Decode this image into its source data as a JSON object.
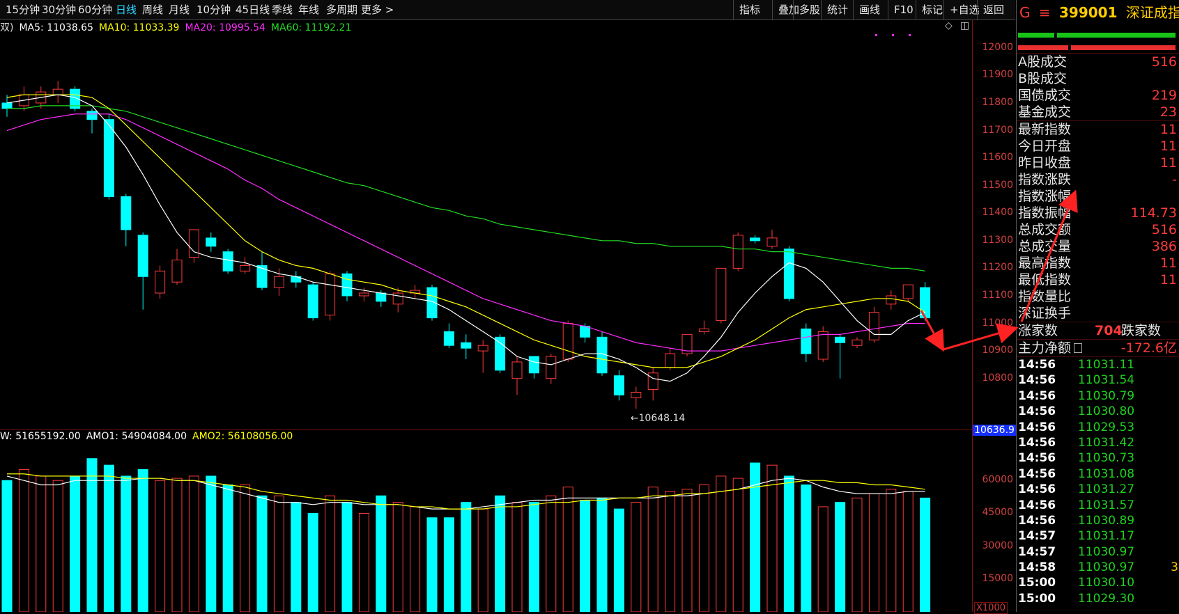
{
  "toolbar": {
    "periods": [
      "15分钟",
      "30分钟",
      "60分钟",
      "日线",
      "周线",
      "月线",
      "10分钟",
      "45日线",
      "季线",
      "年线",
      "多周期",
      "更多 >"
    ],
    "active_index": 3,
    "right_buttons": [
      "指标",
      "叠加",
      "多股",
      "统计",
      "画线",
      "F10",
      "标记",
      "+自选",
      "返回"
    ]
  },
  "main_legend": {
    "prefix": "双)",
    "items": [
      {
        "label": "MA5: 11038.65",
        "color": "#ffffff"
      },
      {
        "label": "MA10: 11033.39",
        "color": "#ffff00"
      },
      {
        "label": "MA20: 10995.54",
        "color": "#ff2bff"
      },
      {
        "label": "MA60: 11192.21",
        "color": "#22dd22"
      }
    ]
  },
  "sub_legend": {
    "items": [
      {
        "label": "W: 51655192.00",
        "color": "#ffffff"
      },
      {
        "label": "AMO1: 54904084.00",
        "color": "#ffffff"
      },
      {
        "label": "AMO2: 56108056.00",
        "color": "#ffff00"
      }
    ]
  },
  "price_axis": {
    "ticks": [
      12000,
      11900,
      11800,
      11700,
      11600,
      11500,
      11400,
      11300,
      11200,
      11100,
      11000,
      10900,
      10800
    ],
    "current_label": "10636.9",
    "low_annotation": "←10648.14"
  },
  "volume_axis": {
    "ticks": [
      "60000",
      "45000",
      "30000",
      "15000"
    ],
    "unit": "X1000"
  },
  "chart_data": {
    "type": "candlestick",
    "price_ylim": [
      10640,
      12050
    ],
    "volume_ylim": [
      0,
      75000
    ],
    "candles": [
      {
        "o": 11800,
        "c": 11780,
        "h": 11830,
        "l": 11750,
        "v": 60000
      },
      {
        "o": 11790,
        "c": 11830,
        "h": 11860,
        "l": 11770,
        "v": 65000
      },
      {
        "o": 11800,
        "c": 11840,
        "h": 11860,
        "l": 11780,
        "v": 62000
      },
      {
        "o": 11830,
        "c": 11850,
        "h": 11880,
        "l": 11800,
        "v": 60000
      },
      {
        "o": 11850,
        "c": 11780,
        "h": 11860,
        "l": 11770,
        "v": 62000
      },
      {
        "o": 11770,
        "c": 11740,
        "h": 11780,
        "l": 11690,
        "v": 70000
      },
      {
        "o": 11740,
        "c": 11460,
        "h": 11760,
        "l": 11450,
        "v": 67000
      },
      {
        "o": 11460,
        "c": 11340,
        "h": 11470,
        "l": 11280,
        "v": 62000
      },
      {
        "o": 11320,
        "c": 11170,
        "h": 11330,
        "l": 11050,
        "v": 65000
      },
      {
        "o": 11110,
        "c": 11190,
        "h": 11210,
        "l": 11090,
        "v": 60000
      },
      {
        "o": 11150,
        "c": 11230,
        "h": 11270,
        "l": 11140,
        "v": 61000
      },
      {
        "o": 11240,
        "c": 11340,
        "h": 11340,
        "l": 11220,
        "v": 62000
      },
      {
        "o": 11310,
        "c": 11280,
        "h": 11330,
        "l": 11260,
        "v": 62000
      },
      {
        "o": 11260,
        "c": 11190,
        "h": 11270,
        "l": 11180,
        "v": 58000
      },
      {
        "o": 11190,
        "c": 11210,
        "h": 11240,
        "l": 11180,
        "v": 58000
      },
      {
        "o": 11210,
        "c": 11130,
        "h": 11260,
        "l": 11120,
        "v": 53000
      },
      {
        "o": 11130,
        "c": 11170,
        "h": 11200,
        "l": 11100,
        "v": 53000
      },
      {
        "o": 11170,
        "c": 11150,
        "h": 11190,
        "l": 11130,
        "v": 50000
      },
      {
        "o": 11140,
        "c": 11020,
        "h": 11150,
        "l": 11010,
        "v": 45000
      },
      {
        "o": 11030,
        "c": 11180,
        "h": 11190,
        "l": 11010,
        "v": 53000
      },
      {
        "o": 11180,
        "c": 11100,
        "h": 11190,
        "l": 11080,
        "v": 50000
      },
      {
        "o": 11100,
        "c": 11110,
        "h": 11130,
        "l": 11080,
        "v": 45000
      },
      {
        "o": 11110,
        "c": 11080,
        "h": 11120,
        "l": 11060,
        "v": 53000
      },
      {
        "o": 11070,
        "c": 11110,
        "h": 11130,
        "l": 11040,
        "v": 50000
      },
      {
        "o": 11110,
        "c": 11120,
        "h": 11140,
        "l": 11090,
        "v": 48000
      },
      {
        "o": 11130,
        "c": 11020,
        "h": 11140,
        "l": 11010,
        "v": 43000
      },
      {
        "o": 10970,
        "c": 10920,
        "h": 11000,
        "l": 10910,
        "v": 43000
      },
      {
        "o": 10930,
        "c": 10910,
        "h": 10960,
        "l": 10870,
        "v": 50000
      },
      {
        "o": 10900,
        "c": 10920,
        "h": 10940,
        "l": 10820,
        "v": 47000
      },
      {
        "o": 10950,
        "c": 10830,
        "h": 10960,
        "l": 10820,
        "v": 53000
      },
      {
        "o": 10800,
        "c": 10860,
        "h": 10880,
        "l": 10740,
        "v": 50000
      },
      {
        "o": 10880,
        "c": 10820,
        "h": 10880,
        "l": 10800,
        "v": 50000
      },
      {
        "o": 10800,
        "c": 10880,
        "h": 10890,
        "l": 10780,
        "v": 53000
      },
      {
        "o": 10870,
        "c": 11000,
        "h": 11010,
        "l": 10860,
        "v": 57000
      },
      {
        "o": 10990,
        "c": 10950,
        "h": 11000,
        "l": 10930,
        "v": 51000
      },
      {
        "o": 10950,
        "c": 10820,
        "h": 10970,
        "l": 10810,
        "v": 52000
      },
      {
        "o": 10810,
        "c": 10740,
        "h": 10830,
        "l": 10720,
        "v": 47000
      },
      {
        "o": 10730,
        "c": 10750,
        "h": 10770,
        "l": 10690,
        "v": 50000
      },
      {
        "o": 10760,
        "c": 10820,
        "h": 10840,
        "l": 10720,
        "v": 57000
      },
      {
        "o": 10840,
        "c": 10890,
        "h": 10910,
        "l": 10830,
        "v": 55000
      },
      {
        "o": 10890,
        "c": 10960,
        "h": 10960,
        "l": 10880,
        "v": 56000
      },
      {
        "o": 10970,
        "c": 10980,
        "h": 11010,
        "l": 10960,
        "v": 58000
      },
      {
        "o": 11010,
        "c": 11200,
        "h": 11200,
        "l": 11000,
        "v": 62000
      },
      {
        "o": 11200,
        "c": 11320,
        "h": 11330,
        "l": 11190,
        "v": 61000
      },
      {
        "o": 11310,
        "c": 11300,
        "h": 11320,
        "l": 11290,
        "v": 68000
      },
      {
        "o": 11280,
        "c": 11310,
        "h": 11340,
        "l": 11270,
        "v": 67000
      },
      {
        "o": 11270,
        "c": 11090,
        "h": 11280,
        "l": 11080,
        "v": 62000
      },
      {
        "o": 10980,
        "c": 10890,
        "h": 11000,
        "l": 10860,
        "v": 58000
      },
      {
        "o": 10870,
        "c": 10970,
        "h": 10990,
        "l": 10860,
        "v": 48000
      },
      {
        "o": 10950,
        "c": 10930,
        "h": 10960,
        "l": 10800,
        "v": 50000
      },
      {
        "o": 10920,
        "c": 10940,
        "h": 10950,
        "l": 10910,
        "v": 52000
      },
      {
        "o": 10940,
        "c": 11040,
        "h": 11060,
        "l": 10930,
        "v": 54000
      },
      {
        "o": 11070,
        "c": 11100,
        "h": 11120,
        "l": 11050,
        "v": 56000
      },
      {
        "o": 11090,
        "c": 11140,
        "h": 11140,
        "l": 11080,
        "v": 55000
      },
      {
        "o": 11130,
        "c": 11020,
        "h": 11150,
        "l": 11010,
        "v": 52000
      }
    ],
    "ma5": [
      11800,
      11810,
      11820,
      11830,
      11820,
      11790,
      11720,
      11640,
      11540,
      11430,
      11330,
      11260,
      11240,
      11230,
      11220,
      11200,
      11180,
      11170,
      11150,
      11140,
      11130,
      11120,
      11110,
      11100,
      11090,
      11080,
      11050,
      11010,
      10970,
      10930,
      10880,
      10860,
      10850,
      10870,
      10890,
      10890,
      10870,
      10840,
      10800,
      10790,
      10820,
      10880,
      10950,
      11040,
      11110,
      11170,
      11220,
      11200,
      11150,
      11080,
      11010,
      10960,
      10960,
      11010,
      11040
    ],
    "ma10": [
      11820,
      11830,
      11830,
      11830,
      11830,
      11820,
      11780,
      11720,
      11660,
      11600,
      11540,
      11480,
      11420,
      11360,
      11300,
      11260,
      11230,
      11210,
      11200,
      11180,
      11160,
      11150,
      11140,
      11120,
      11110,
      11100,
      11080,
      11060,
      11030,
      11000,
      10970,
      10940,
      10920,
      10900,
      10880,
      10870,
      10860,
      10850,
      10840,
      10840,
      10840,
      10860,
      10880,
      10910,
      10940,
      10980,
      11020,
      11050,
      11060,
      11070,
      11080,
      11090,
      11090,
      11080,
      11040
    ],
    "ma20": [
      11700,
      11720,
      11740,
      11750,
      11760,
      11760,
      11760,
      11740,
      11710,
      11680,
      11650,
      11620,
      11590,
      11560,
      11520,
      11490,
      11450,
      11420,
      11390,
      11360,
      11330,
      11300,
      11270,
      11240,
      11210,
      11180,
      11150,
      11120,
      11090,
      11070,
      11050,
      11030,
      11010,
      11000,
      10990,
      10970,
      10950,
      10930,
      10920,
      10910,
      10900,
      10900,
      10900,
      10910,
      10920,
      10930,
      10940,
      10950,
      10960,
      10960,
      10970,
      10980,
      10990,
      11000,
      11000
    ],
    "ma60": [
      11780,
      11780,
      11790,
      11790,
      11790,
      11790,
      11780,
      11770,
      11750,
      11730,
      11710,
      11690,
      11670,
      11650,
      11630,
      11610,
      11590,
      11570,
      11550,
      11530,
      11510,
      11500,
      11480,
      11460,
      11440,
      11420,
      11410,
      11390,
      11380,
      11360,
      11350,
      11340,
      11330,
      11320,
      11310,
      11300,
      11300,
      11290,
      11290,
      11280,
      11280,
      11280,
      11280,
      11270,
      11270,
      11260,
      11260,
      11250,
      11240,
      11230,
      11220,
      11210,
      11200,
      11200,
      11190
    ],
    "vol_w": [
      62000,
      60000,
      58000,
      58000,
      60000,
      60000,
      60000,
      60000,
      61000,
      61000,
      60000,
      60000,
      58000,
      56000,
      54000,
      52000,
      50000,
      50000,
      49000,
      50000,
      50000,
      49000,
      49000,
      49000,
      48000,
      47000,
      47000,
      47000,
      48000,
      49000,
      50000,
      51000,
      51000,
      52000,
      52000,
      52000,
      52000,
      52000,
      52000,
      53000,
      53000,
      54000,
      55000,
      56000,
      58000,
      60000,
      61000,
      60000,
      57000,
      55000,
      54000,
      54000,
      54000,
      55000,
      55000
    ],
    "vol_ma2": [
      63000,
      63000,
      62000,
      62000,
      62000,
      62000,
      62000,
      61000,
      61000,
      61000,
      60000,
      60000,
      59000,
      58000,
      57000,
      55000,
      54000,
      53000,
      52000,
      51000,
      51000,
      50000,
      49000,
      49000,
      48000,
      48000,
      47000,
      47000,
      47000,
      48000,
      48000,
      49000,
      50000,
      50000,
      51000,
      51000,
      52000,
      52000,
      53000,
      53000,
      54000,
      54000,
      55000,
      56000,
      57000,
      58000,
      59000,
      60000,
      60000,
      59000,
      59000,
      58000,
      58000,
      57000,
      56000
    ]
  },
  "panel": {
    "flag": "G",
    "menu_icon": "≡",
    "code": "399001",
    "name": "深证成指",
    "group1": [
      {
        "label": "A股成交",
        "value": "516"
      },
      {
        "label": "B股成交",
        "value": ""
      },
      {
        "label": "国债成交",
        "value": "219"
      },
      {
        "label": "基金成交",
        "value": "23"
      }
    ],
    "group2": [
      {
        "label": "最新指数",
        "value": "11"
      },
      {
        "label": "今日开盘",
        "value": "11"
      },
      {
        "label": "昨日收盘",
        "value": "11"
      },
      {
        "label": "指数涨跌",
        "value": "-"
      },
      {
        "label": "指数涨幅",
        "value": ""
      },
      {
        "label": "指数振幅",
        "value": "114.73"
      },
      {
        "label": "总成交额",
        "value": "516"
      },
      {
        "label": "总成交量",
        "value": "386"
      },
      {
        "label": "最高指数",
        "value": "11"
      },
      {
        "label": "最低指数",
        "value": "11"
      },
      {
        "label": "指数量比",
        "value": ""
      },
      {
        "label": "深证换手",
        "value": ""
      }
    ],
    "up_label": "涨家数",
    "up_value": "",
    "down_count": "704",
    "down_label": "跌家数",
    "net_label": "主力净额",
    "net_value": "-172.6亿",
    "ticks": [
      {
        "time": "14:56",
        "price": "11031.11",
        "extra": ""
      },
      {
        "time": "14:56",
        "price": "11031.54",
        "extra": ""
      },
      {
        "time": "14:56",
        "price": "11030.79",
        "extra": ""
      },
      {
        "time": "14:56",
        "price": "11030.80",
        "extra": ""
      },
      {
        "time": "14:56",
        "price": "11029.53",
        "extra": ""
      },
      {
        "time": "14:56",
        "price": "11031.42",
        "extra": ""
      },
      {
        "time": "14:56",
        "price": "11030.73",
        "extra": ""
      },
      {
        "time": "14:56",
        "price": "11031.08",
        "extra": ""
      },
      {
        "time": "14:56",
        "price": "11031.27",
        "extra": ""
      },
      {
        "time": "14:56",
        "price": "11031.57",
        "extra": ""
      },
      {
        "time": "14:56",
        "price": "11030.89",
        "extra": ""
      },
      {
        "time": "14:57",
        "price": "11031.17",
        "extra": ""
      },
      {
        "time": "14:57",
        "price": "11030.97",
        "extra": ""
      },
      {
        "time": "14:58",
        "price": "11030.97",
        "extra": "3"
      },
      {
        "time": "15:00",
        "price": "11030.10",
        "extra": ""
      },
      {
        "time": "15:00",
        "price": "11029.30",
        "extra": ""
      }
    ]
  },
  "colors": {
    "up": "#ff3b3b",
    "down": "#00ffff",
    "ma5": "#ffffff",
    "ma10": "#ffff00",
    "ma20": "#ff2bff",
    "ma60": "#22dd22",
    "annot": "#ff2222"
  }
}
